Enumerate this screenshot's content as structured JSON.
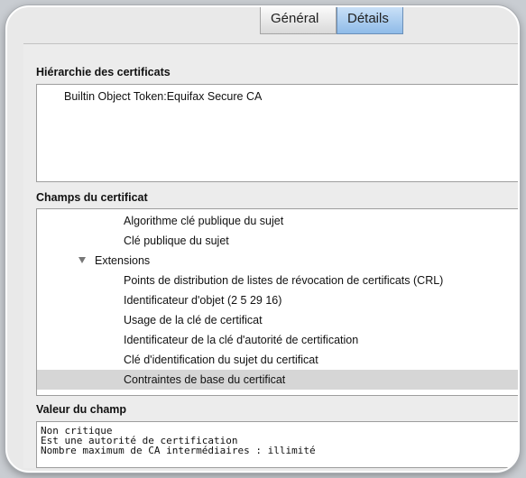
{
  "tabs": [
    {
      "label": "Général",
      "selected": false
    },
    {
      "label": "Détails",
      "selected": true
    }
  ],
  "hierarchy": {
    "label": "Hiérarchie des certificats",
    "items": [
      "Builtin Object Token:Equifax Secure CA"
    ]
  },
  "fields": {
    "label": "Champs du certificat",
    "rows": [
      {
        "text": "Algorithme clé publique du sujet"
      },
      {
        "text": "Clé publique du sujet"
      },
      {
        "text": "Extensions",
        "expandable": true
      },
      {
        "text": "Points de distribution de listes de révocation de certificats (CRL)"
      },
      {
        "text": "Identificateur d'objet (2 5 29 16)"
      },
      {
        "text": "Usage de la clé de certificat"
      },
      {
        "text": "Identificateur de la clé d'autorité de certification"
      },
      {
        "text": "Clé d'identification du sujet du certificat"
      },
      {
        "text": "Contraintes de base du certificat",
        "selected": true
      }
    ]
  },
  "value": {
    "label": "Valeur du champ",
    "lines": [
      "Non critique",
      "Est une autorité de certification",
      "Nombre maximum de CA intermédiaires : illimité"
    ]
  },
  "colors": {
    "selected_tab": "#8fbbe8",
    "selected_row": "#d6d6d6"
  }
}
